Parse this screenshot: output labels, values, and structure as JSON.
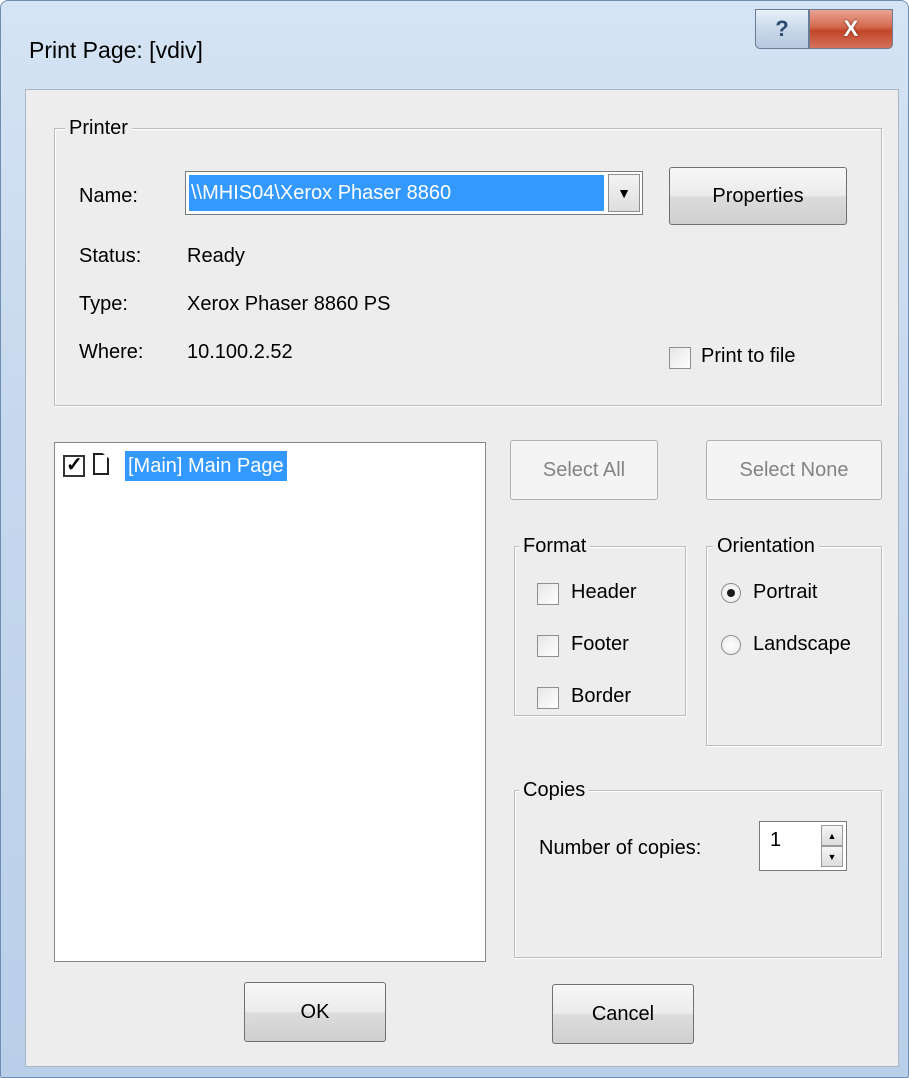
{
  "window": {
    "title": "Print Page: [vdiv]",
    "help_glyph": "?",
    "close_glyph": "X"
  },
  "printer": {
    "group_label": "Printer",
    "name_label": "Name:",
    "name_value": "\\\\MHIS04\\Xerox Phaser 8860",
    "properties_label": "Properties",
    "status_label": "Status:",
    "status_value": "Ready",
    "type_label": "Type:",
    "type_value": "Xerox Phaser 8860 PS",
    "where_label": "Where:",
    "where_value": "10.100.2.52",
    "print_to_file_label": "Print to file",
    "print_to_file_checked": false
  },
  "pages": {
    "items": [
      {
        "label": "[Main] Main Page",
        "checked": true,
        "selected": true
      }
    ]
  },
  "selection": {
    "select_all_label": "Select All",
    "select_none_label": "Select None"
  },
  "format": {
    "group_label": "Format",
    "options": [
      {
        "label": "Header",
        "checked": false
      },
      {
        "label": "Footer",
        "checked": false
      },
      {
        "label": "Border",
        "checked": false
      }
    ]
  },
  "orientation": {
    "group_label": "Orientation",
    "options": [
      {
        "label": "Portrait",
        "selected": true
      },
      {
        "label": "Landscape",
        "selected": false
      }
    ]
  },
  "copies": {
    "group_label": "Copies",
    "number_label": "Number of copies:",
    "value": "1"
  },
  "footer": {
    "ok_label": "OK",
    "cancel_label": "Cancel"
  },
  "colors": {
    "selection": "#3399ff",
    "dialog_bg": "#ededed",
    "close_button": "#c24628"
  }
}
